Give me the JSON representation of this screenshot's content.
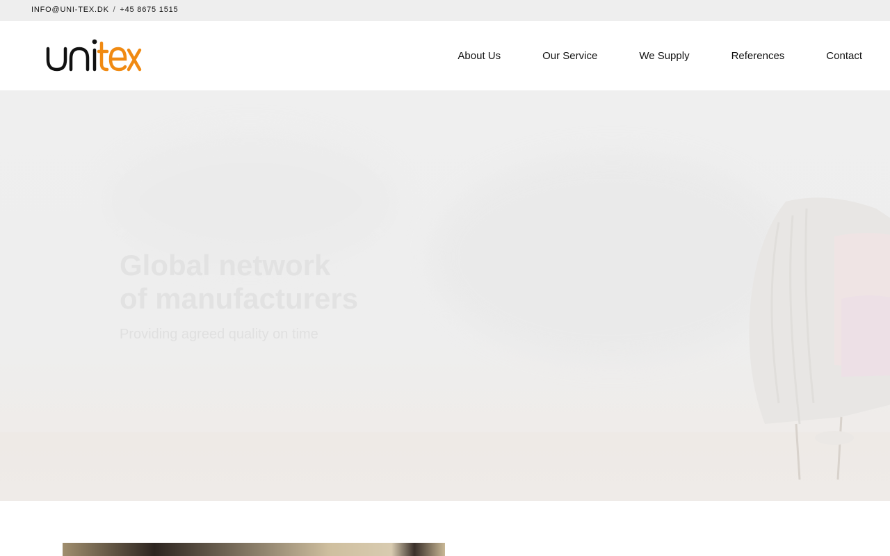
{
  "topbar": {
    "email": "INFO@UNI-TEX.DK",
    "separator": "/",
    "phone": "+45 8675 1515"
  },
  "brand": {
    "logo_text_part1": "uni",
    "logo_text_part2": "tex",
    "colors": {
      "dark": "#111111",
      "accent": "#f08a12"
    }
  },
  "nav": {
    "items": [
      {
        "label": "About Us"
      },
      {
        "label": "Our Service"
      },
      {
        "label": "We Supply"
      },
      {
        "label": "References"
      },
      {
        "label": "Contact"
      }
    ]
  },
  "hero": {
    "title_line1": "Global network",
    "title_line2": "of manufacturers",
    "subtitle": "Providing agreed quality on time"
  }
}
